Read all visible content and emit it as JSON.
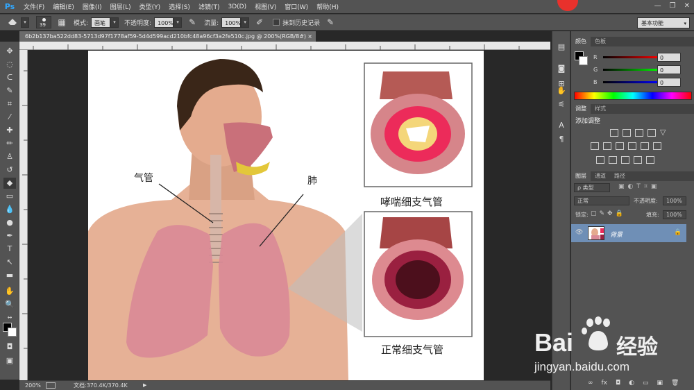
{
  "app": {
    "logo": "Ps"
  },
  "menu": [
    {
      "label": "文件(F)"
    },
    {
      "label": "编辑(E)"
    },
    {
      "label": "图像(I)"
    },
    {
      "label": "图层(L)"
    },
    {
      "label": "类型(Y)"
    },
    {
      "label": "选择(S)"
    },
    {
      "label": "滤镜(T)"
    },
    {
      "label": "3D(D)"
    },
    {
      "label": "视图(V)"
    },
    {
      "label": "窗口(W)"
    },
    {
      "label": "帮助(H)"
    }
  ],
  "window_controls": {
    "minimize": "—",
    "restore": "❐",
    "close": "✕"
  },
  "options_bar": {
    "brush_size": "39",
    "mode_label": "模式:",
    "mode_value": "画笔",
    "opacity_label": "不透明度:",
    "opacity_value": "100%",
    "flow_label": "流量:",
    "flow_value": "100%",
    "history_label": "抹到历史记录",
    "workspace": "基本功能"
  },
  "document": {
    "tab_title": "6b2b137ba522dd83-5713d97f1778af59-5d4d599acd210bfc48a96cf3a2fe510c.jpg @ 200%(RGB/8#)",
    "close": "×"
  },
  "artwork": {
    "label_trachea": "气管",
    "label_lung": "肺",
    "label_asthma": "哮喘细支气管",
    "label_normal": "正常细支气管"
  },
  "status": {
    "zoom": "200%",
    "doc_info": "文档:370.4K/370.4K"
  },
  "color_panel": {
    "tabs": [
      "颜色",
      "色板"
    ],
    "channels": [
      {
        "name": "R",
        "value": "0",
        "color": "#cc2222"
      },
      {
        "name": "G",
        "value": "0",
        "color": "#22aa22"
      },
      {
        "name": "B",
        "value": "0",
        "color": "#2233cc"
      }
    ]
  },
  "adjust_panel": {
    "tabs": [
      "调整",
      "样式"
    ],
    "title": "添加调整"
  },
  "layers_panel": {
    "tabs": [
      "图层",
      "通道",
      "路径"
    ],
    "filter_label": "ρ 类型",
    "blend_mode": "正常",
    "opacity_label": "不透明度:",
    "opacity_value": "100%",
    "lock_label": "锁定:",
    "fill_label": "填充:",
    "fill_value": "100%",
    "layers": [
      {
        "name": "背景",
        "visible_icon": "👁"
      }
    ],
    "bottom_icons": [
      "∞",
      "fx",
      "◘",
      "◐",
      "▭",
      "▣",
      "🗑"
    ]
  },
  "watermark": {
    "brand": "Bai",
    "brand_cn": "经验",
    "url": "jingyan.baidu.com"
  },
  "colors": {
    "ui_bg": "#535353",
    "panel_dark": "#424242",
    "selection": "#6f8fb6",
    "ps_blue": "#31a8ff"
  }
}
